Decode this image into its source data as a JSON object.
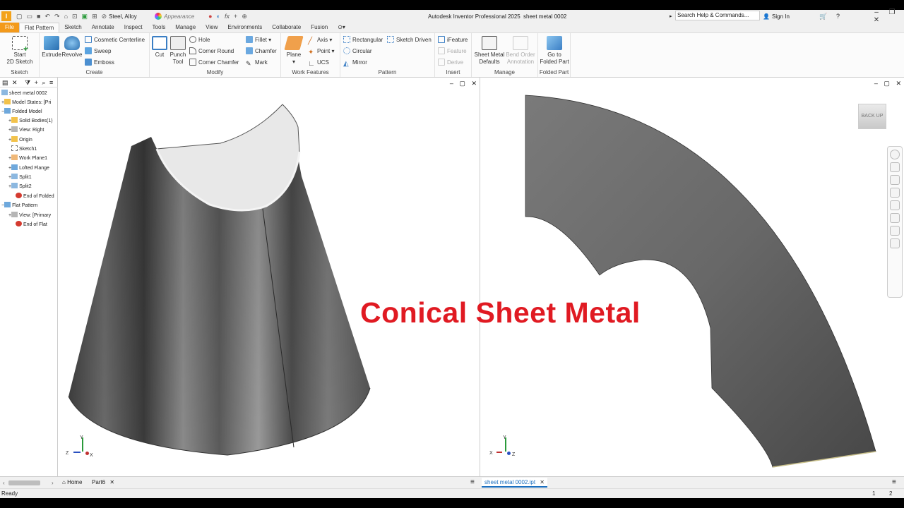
{
  "titlebar": {
    "material": "Steel, Alloy",
    "appearance": "Appearance",
    "fx": "fx",
    "app_title": "Autodesk Inventor Professional 2025",
    "doc_title": "sheet metal 0002",
    "search_placeholder": "Search Help & Commands...",
    "sign_in": "Sign In"
  },
  "tabs": [
    "File",
    "Flat Pattern",
    "Sketch",
    "Annotate",
    "Inspect",
    "Tools",
    "Manage",
    "View",
    "Environments",
    "Collaborate",
    "Fusion"
  ],
  "ribbon": {
    "sketch": {
      "start": "Start",
      "start2": "2D Sketch",
      "label": "Sketch"
    },
    "create": {
      "extrude": "Extrude",
      "revolve": "Revolve",
      "cosmetic": "Cosmetic Centerline",
      "sweep": "Sweep",
      "emboss": "Emboss",
      "label": "Create"
    },
    "modify": {
      "cut": "Cut",
      "punch": "Punch",
      "punch2": "Tool",
      "hole": "Hole",
      "corner_round": "Corner Round",
      "corner_chamfer": "Corner Chamfer",
      "fillet": "Fillet",
      "chamfer": "Chamfer",
      "mark": "Mark",
      "label": "Modify"
    },
    "work": {
      "plane": "Plane",
      "axis": "Axis",
      "point": "Point",
      "ucs": "UCS",
      "label": "Work Features"
    },
    "pattern": {
      "rectangular": "Rectangular",
      "circular": "Circular",
      "mirror": "Mirror",
      "sketch_driven": "Sketch Driven",
      "label": "Pattern"
    },
    "insert": {
      "ifeature": "iFeature",
      "feature": "Feature",
      "derive": "Derive",
      "label": "Insert"
    },
    "manage": {
      "smd1": "Sheet Metal",
      "smd2": "Defaults",
      "boa1": "Bend Order",
      "boa2": "Annotation",
      "label": "Manage"
    },
    "folded": {
      "goto1": "Go to",
      "goto2": "Folded Part",
      "label": "Folded Part"
    }
  },
  "browser": {
    "items": [
      {
        "label": "sheet metal 0002"
      },
      {
        "label": "Model States: [Pri"
      },
      {
        "label": "Folded Model"
      },
      {
        "label": "Solid Bodies(1)"
      },
      {
        "label": "View: Right"
      },
      {
        "label": "Origin"
      },
      {
        "label": "Sketch1"
      },
      {
        "label": "Work Plane1"
      },
      {
        "label": "Lofted Flange"
      },
      {
        "label": "Split1"
      },
      {
        "label": "Split2"
      },
      {
        "label": "End of Folded"
      },
      {
        "label": "Flat Pattern"
      },
      {
        "label": "View: [Primary"
      },
      {
        "label": "End of Flat"
      }
    ]
  },
  "viewcube": {
    "back": "BACK",
    "up": "UP"
  },
  "axes": {
    "x": "X",
    "y": "Y",
    "z": "Z"
  },
  "doc_tabs": {
    "home": "Home",
    "part6": "Part6",
    "active": "sheet metal 0002.ipt"
  },
  "status": {
    "text": "Ready",
    "n1": "1",
    "n2": "2"
  },
  "overlay_text": "Conical Sheet Metal"
}
